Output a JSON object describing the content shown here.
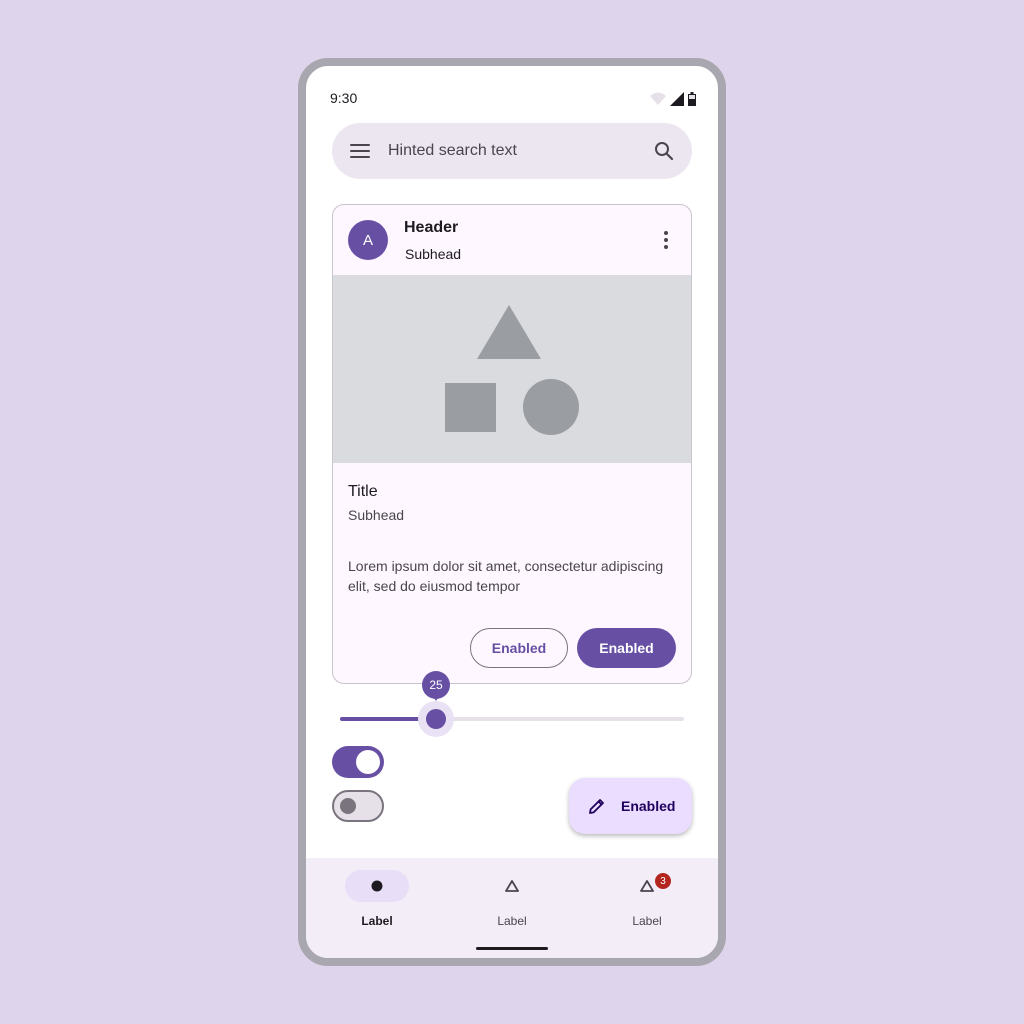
{
  "status_bar": {
    "time": "9:30"
  },
  "search": {
    "placeholder": "Hinted search text",
    "menu_icon": "menu-icon",
    "search_icon": "search-icon"
  },
  "card": {
    "avatar_letter": "A",
    "header": "Header",
    "header_subhead": "Subhead",
    "title": "Title",
    "subhead": "Subhead",
    "body": "Lorem ipsum dolor sit amet, consectetur adipiscing elit, sed do eiusmod tempor",
    "outlined_button": "Enabled",
    "filled_button": "Enabled"
  },
  "slider": {
    "value": 25,
    "min": 0,
    "max": 100,
    "label": "25"
  },
  "switches": [
    {
      "state": "on"
    },
    {
      "state": "off"
    }
  ],
  "fab": {
    "label": "Enabled",
    "icon": "edit-icon"
  },
  "nav": {
    "items": [
      {
        "label": "Label",
        "icon": "circle-icon",
        "active": true
      },
      {
        "label": "Label",
        "icon": "triangle-icon",
        "active": false
      },
      {
        "label": "Label",
        "icon": "triangle-icon",
        "active": false,
        "badge": "3"
      }
    ]
  },
  "colors": {
    "primary": "#6750A4",
    "surface": "#FEF7FF",
    "background": "#DED5EC",
    "badge": "#B3261E"
  }
}
